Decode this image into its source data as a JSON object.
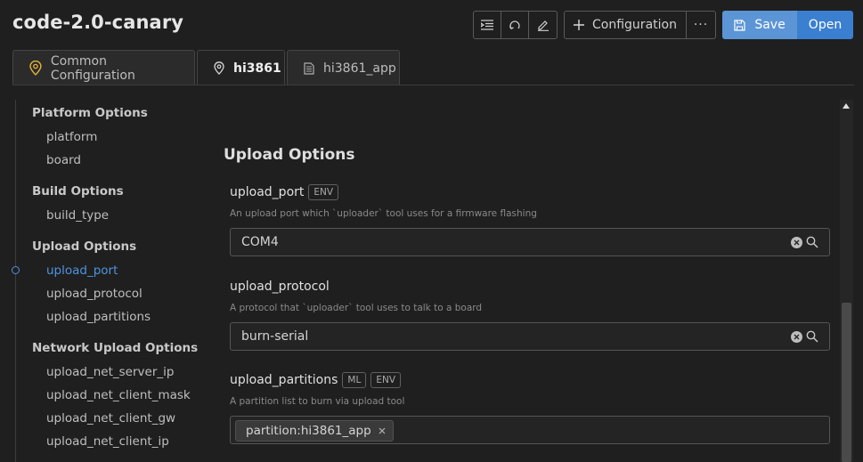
{
  "app": {
    "title": "code-2.0-canary"
  },
  "toolbar": {
    "configuration_label": "Configuration",
    "more_label": "···",
    "save_label": "Save",
    "open_label": "Open"
  },
  "tabs": [
    {
      "label": "Common Configuration",
      "icon": "location-pin-icon"
    },
    {
      "label": "hi3861",
      "icon": "location-pin-icon",
      "active": true
    },
    {
      "label": "hi3861_app",
      "icon": "document-icon"
    }
  ],
  "sidebar": {
    "groups": [
      {
        "title": "Platform Options",
        "items": [
          "platform",
          "board"
        ]
      },
      {
        "title": "Build Options",
        "items": [
          "build_type"
        ]
      },
      {
        "title": "Upload Options",
        "items": [
          "upload_port",
          "upload_protocol",
          "upload_partitions"
        ]
      },
      {
        "title": "Network Upload Options",
        "items": [
          "upload_net_server_ip",
          "upload_net_client_mask",
          "upload_net_client_gw",
          "upload_net_client_ip"
        ]
      }
    ],
    "active_item": "upload_port"
  },
  "main": {
    "section_title": "Upload Options",
    "options": [
      {
        "name": "upload_port",
        "badges": [
          "ENV"
        ],
        "description": "An upload port which `uploader` tool uses for a firmware flashing",
        "value": "COM4"
      },
      {
        "name": "upload_protocol",
        "badges": [],
        "description": "A protocol that `uploader` tool uses to talk to a board",
        "value": "burn-serial"
      },
      {
        "name": "upload_partitions",
        "badges": [
          "ML",
          "ENV"
        ],
        "description": "A partition list to burn via upload tool",
        "chips": [
          "partition:hi3861_app"
        ]
      }
    ]
  },
  "colors": {
    "accent": "#4e94e0",
    "save_button": "#5c95d6",
    "open_button": "#3a7fd0",
    "background": "#1f1f1f"
  }
}
